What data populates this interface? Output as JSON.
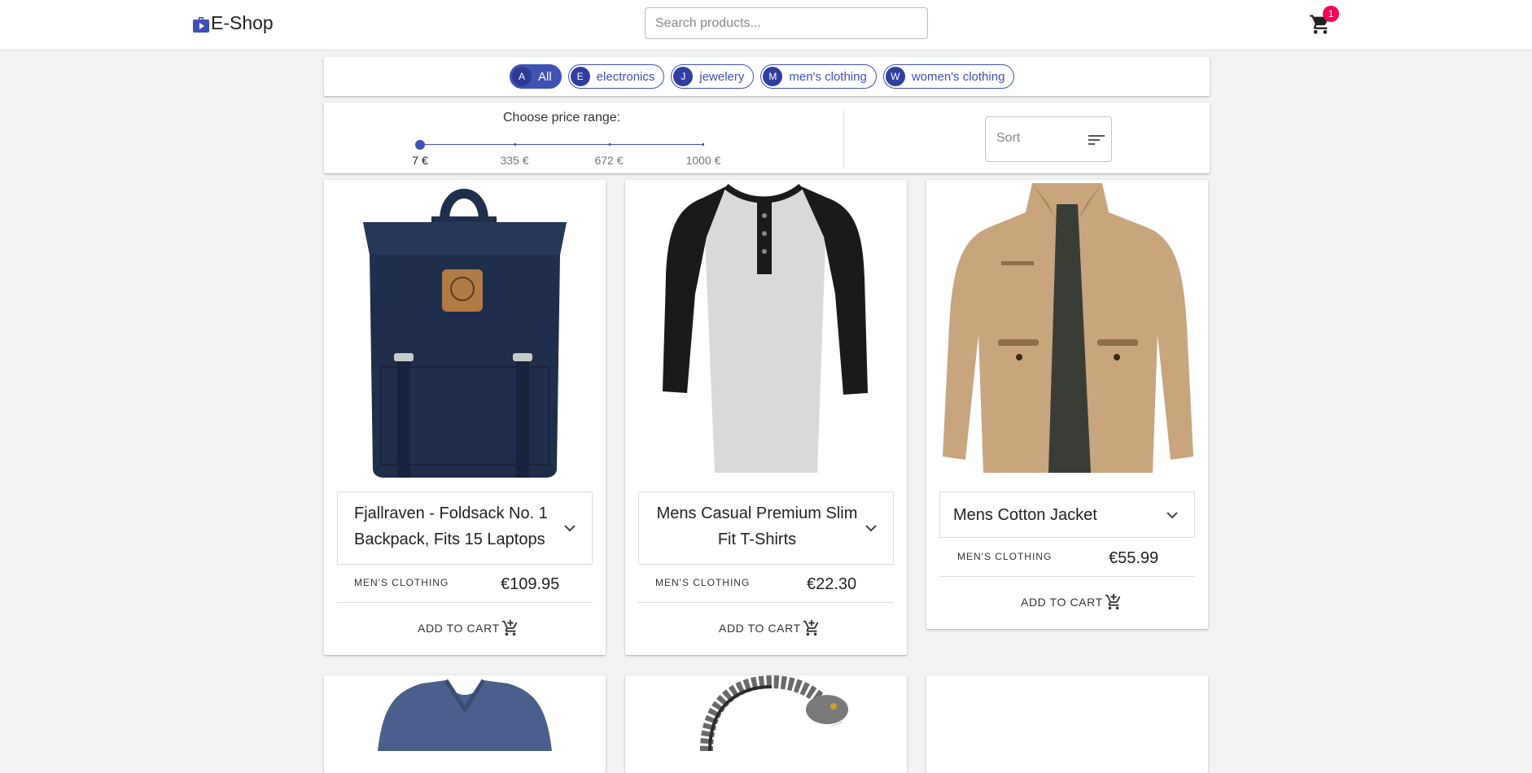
{
  "header": {
    "brand": "E-Shop",
    "search_placeholder": "Search products...",
    "cart_count": "1"
  },
  "categories": [
    {
      "avatar": "A",
      "label": "All",
      "active": true
    },
    {
      "avatar": "E",
      "label": "electronics",
      "active": false
    },
    {
      "avatar": "J",
      "label": "jewelery",
      "active": false
    },
    {
      "avatar": "M",
      "label": "men's clothing",
      "active": false
    },
    {
      "avatar": "W",
      "label": "women's clothing",
      "active": false
    }
  ],
  "price_filter": {
    "title": "Choose price range:",
    "marks": [
      "7 €",
      "335 €",
      "672 €",
      "1000 €"
    ],
    "selected_value": 7
  },
  "sort": {
    "label": "Sort"
  },
  "products": [
    {
      "title": "Fjallraven - Foldsack No. 1 Backpack, Fits 15 Laptops",
      "category": "MEN'S CLOTHING",
      "price": "€109.95",
      "add_label": "ADD TO CART"
    },
    {
      "title": "Mens Casual Premium Slim Fit T-Shirts",
      "category": "MEN'S CLOTHING",
      "price": "€22.30",
      "add_label": "ADD TO CART"
    },
    {
      "title": "Mens Cotton Jacket",
      "category": "MEN'S CLOTHING",
      "price": "€55.99",
      "add_label": "ADD TO CART"
    }
  ],
  "colors": {
    "primary": "#3f51b5",
    "badge": "#f50057",
    "backpack": "#1f2e4d",
    "tshirt_body": "#d9d9d9",
    "tshirt_sleeves": "#1a1a1a",
    "jacket": "#c9a57e",
    "sweater": "#4a5f8c"
  }
}
